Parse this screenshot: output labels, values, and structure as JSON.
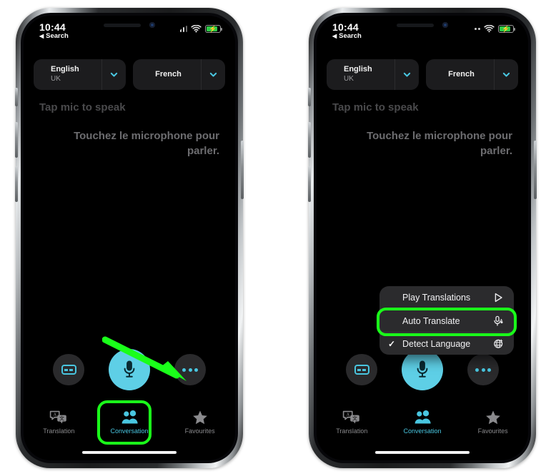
{
  "page": {
    "background": "#ffffff",
    "accent_cyan": "#49c6e0",
    "highlight_green": "#1aff1a",
    "mic_button_color": "#5ecfe6"
  },
  "status_bar": {
    "time": "10:44",
    "back_label": "Search",
    "back_caret": "◀",
    "signal_icon": "signal-bars-icon",
    "wifi_icon": "wifi-icon",
    "battery_icon": "battery-charging-icon",
    "battery_bolt": "⚡"
  },
  "language_bar": {
    "source": {
      "name": "English",
      "region": "UK",
      "chevron": "chevron-down-icon"
    },
    "target": {
      "name": "French",
      "region": "",
      "chevron": "chevron-down-icon"
    }
  },
  "transcript": {
    "source_prompt": "Tap mic to speak",
    "target_prompt": "Touchez le microphone pour parler."
  },
  "controls": {
    "captions_label": "Show Captions",
    "mic_label": "Microphone",
    "more_label": "More Options"
  },
  "tabs": [
    {
      "label": "Translation",
      "icon": "translation-bubbles-icon",
      "active": false
    },
    {
      "label": "Conversation",
      "icon": "two-people-icon",
      "active": true
    },
    {
      "label": "Favourites",
      "icon": "star-icon",
      "active": false
    }
  ],
  "popup_menu": {
    "items": [
      {
        "label": "Play Translations",
        "icon": "play-triangle-icon",
        "checked": false,
        "highlighted": false
      },
      {
        "label": "Auto Translate",
        "icon": "mic-waveform-icon",
        "checked": false,
        "highlighted": true
      },
      {
        "label": "Detect Language",
        "icon": "globe-sparkle-icon",
        "checked": true,
        "highlighted": false
      }
    ],
    "check_glyph": "✓"
  },
  "annotations": {
    "left_arrow": {
      "icon": "green-arrow-icon",
      "points_to": "more-options-button"
    },
    "left_tab_highlight": {
      "target": "tab-conversation"
    },
    "right_menu_highlight": {
      "target": "menu-item-auto-translate"
    }
  }
}
